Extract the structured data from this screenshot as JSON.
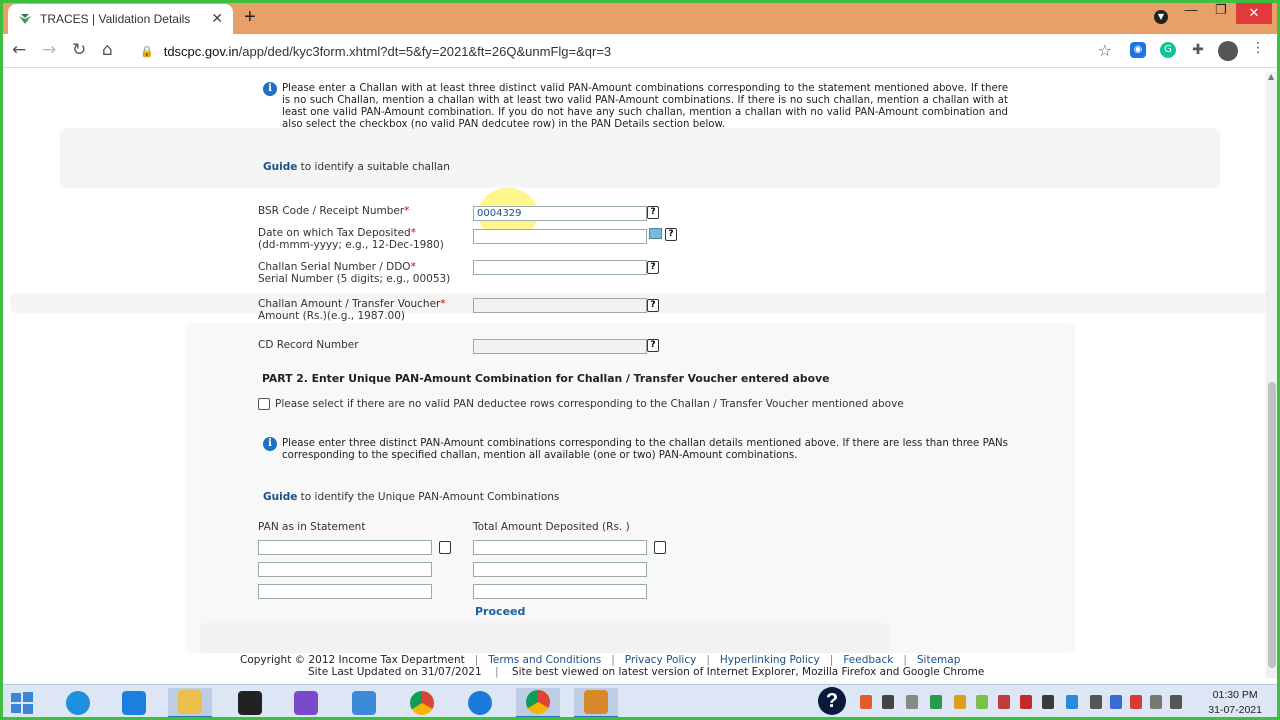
{
  "browser": {
    "tab_title": "TRACES | Validation Details",
    "tab_close": "✕",
    "new_tab": "+",
    "url_host": "tdscpc.gov.in",
    "url_path": "/app/ded/kyc3form.xhtml?dt=5&fy=2021&ft=26Q&unmFlg=&qr=3",
    "window_controls": {
      "minimize": "—",
      "maximize": "❐",
      "close": "✕"
    }
  },
  "part1": {
    "info_text": "Please enter a Challan with at least three distinct valid PAN-Amount combinations corresponding to the statement mentioned above. If there is no such Challan, mention a challan with at least two valid PAN-Amount combinations. If there is no such challan, mention a challan with at least one valid PAN-Amount combination. If you do not have any such challan, mention a challan with no valid PAN-Amount combination and also select the checkbox (no valid PAN dedcutee row) in the PAN Details section below.",
    "guide_link": "Guide",
    "guide_text": " to identify a suitable challan",
    "fields": [
      {
        "label_line1": "BSR Code / Receipt Number",
        "label_line2": "",
        "value": "0004329"
      },
      {
        "label_line1": "Date on which Tax Deposited",
        "label_line2": "(dd-mmm-yyyy; e.g., 12-Dec-1980)",
        "value": ""
      },
      {
        "label_line1": "Challan Serial Number / DDO",
        "label_line2": "Serial Number (5 digits; e.g., 00053)",
        "value": ""
      },
      {
        "label_line1": "Challan Amount / Transfer Voucher",
        "label_line2": "Amount (Rs.)(e.g., 1987.00)",
        "value": ""
      },
      {
        "label_line1": "CD Record Number",
        "label_line2": "",
        "value": ""
      }
    ],
    "required_mark": "*",
    "help_glyph": "?"
  },
  "part2": {
    "heading": "PART 2. Enter Unique PAN-Amount Combination for Challan / Transfer Voucher entered above",
    "checkbox_label": "Please select if there are no valid PAN deductee rows corresponding to the Challan / Transfer Voucher mentioned above",
    "info_text": "Please enter three distinct PAN-Amount combinations corresponding to the challan details mentioned above. If there are less than three PANs corresponding to the specified challan, mention all available (one or two) PAN-Amount combinations.",
    "guide_link": "Guide",
    "guide_text": " to identify the Unique PAN-Amount Combinations",
    "pan_header": "PAN as in Statement",
    "amount_header": "Total Amount Deposited (Rs. )",
    "proceed": "Proceed"
  },
  "footer": {
    "copyright": "Copyright © 2012 Income Tax Department",
    "links": [
      "Terms and Conditions",
      "Privacy Policy",
      "Hyperlinking Policy",
      "Feedback",
      "Sitemap"
    ],
    "separator": "|",
    "last_updated": "Site Last Updated on 31/07/2021",
    "best_viewed": "Site best viewed on latest version of Internet Explorer, Mozilla Firefox and Google Chrome"
  },
  "taskbar": {
    "time": "01:30 PM",
    "date": "31-07-2021"
  },
  "colors": {
    "titlebar": "#e8a06a",
    "frame": "#3fbf3f",
    "link": "#1a4f8a",
    "required": "#dd0000"
  }
}
